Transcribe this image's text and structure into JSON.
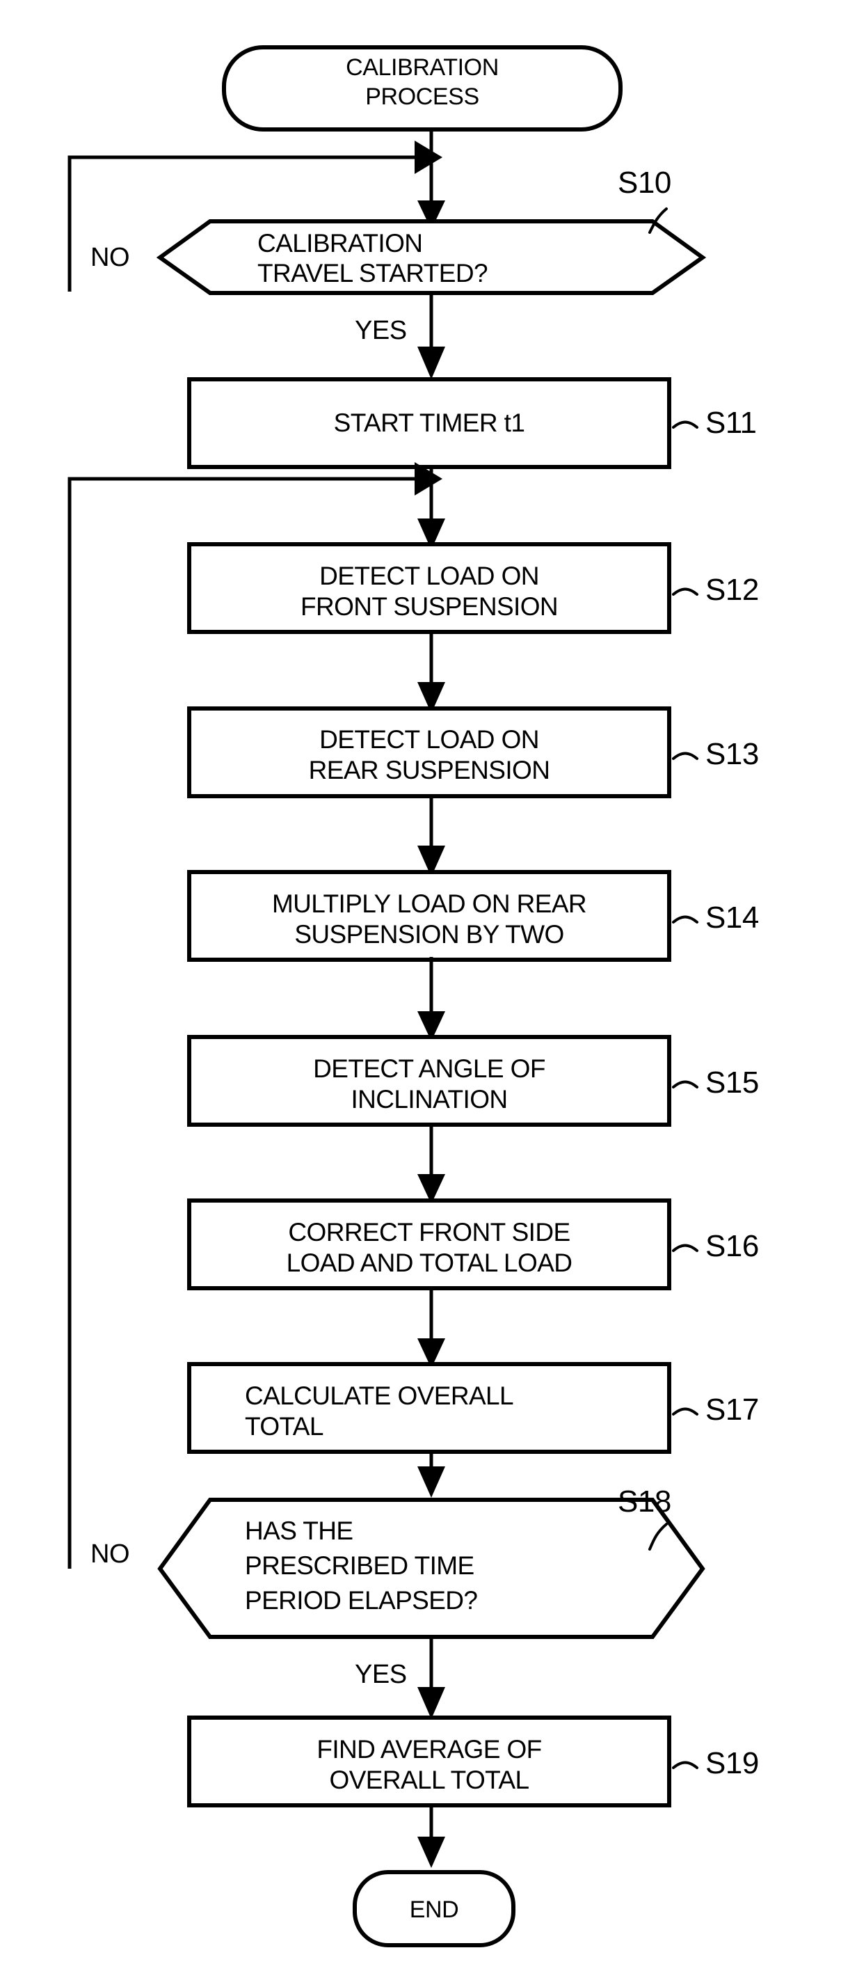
{
  "diagram": {
    "type": "flowchart",
    "title": "CALIBRATION PROCESS",
    "nodes": [
      {
        "id": "start",
        "shape": "terminator",
        "lines": [
          "CALIBRATION",
          "PROCESS"
        ],
        "step": ""
      },
      {
        "id": "s10",
        "shape": "decision",
        "lines": [
          "CALIBRATION",
          "TRAVEL STARTED?"
        ],
        "step": "S10",
        "yes": "YES",
        "no": "NO"
      },
      {
        "id": "s11",
        "shape": "process",
        "lines": [
          "START TIMER t1"
        ],
        "step": "S11"
      },
      {
        "id": "s12",
        "shape": "process",
        "lines": [
          "DETECT LOAD ON",
          "FRONT SUSPENSION"
        ],
        "step": "S12"
      },
      {
        "id": "s13",
        "shape": "process",
        "lines": [
          "DETECT LOAD ON",
          "REAR SUSPENSION"
        ],
        "step": "S13"
      },
      {
        "id": "s14",
        "shape": "process",
        "lines": [
          "MULTIPLY LOAD ON REAR",
          "SUSPENSION BY TWO"
        ],
        "step": "S14"
      },
      {
        "id": "s15",
        "shape": "process",
        "lines": [
          "DETECT ANGLE OF",
          "INCLINATION"
        ],
        "step": "S15"
      },
      {
        "id": "s16",
        "shape": "process",
        "lines": [
          "CORRECT FRONT SIDE",
          "LOAD AND TOTAL LOAD"
        ],
        "step": "S16"
      },
      {
        "id": "s17",
        "shape": "process",
        "lines": [
          "CALCULATE OVERALL",
          "TOTAL"
        ],
        "step": "S17"
      },
      {
        "id": "s18",
        "shape": "decision",
        "lines": [
          "HAS THE",
          "PRESCRIBED TIME",
          "PERIOD ELAPSED?"
        ],
        "step": "S18",
        "yes": "YES",
        "no": "NO"
      },
      {
        "id": "s19",
        "shape": "process",
        "lines": [
          "FIND AVERAGE OF",
          "OVERALL TOTAL"
        ],
        "step": "S19"
      },
      {
        "id": "end",
        "shape": "terminator",
        "lines": [
          "END"
        ],
        "step": ""
      }
    ],
    "colors": {
      "stroke": "#000000",
      "fill": "#ffffff",
      "background": "#ffffff"
    }
  },
  "nodes": {
    "start": {
      "l0": "CALIBRATION",
      "l1": "PROCESS"
    },
    "s10": {
      "l0": "CALIBRATION",
      "l1": "TRAVEL STARTED?",
      "step": "S10",
      "no": "NO",
      "yes": "YES"
    },
    "s11": {
      "l0": "START TIMER t1",
      "step": "S11"
    },
    "s12": {
      "l0": "DETECT LOAD ON",
      "l1": "FRONT SUSPENSION",
      "step": "S12"
    },
    "s13": {
      "l0": "DETECT LOAD ON",
      "l1": "REAR SUSPENSION",
      "step": "S13"
    },
    "s14": {
      "l0": "MULTIPLY LOAD ON REAR",
      "l1": "SUSPENSION BY TWO",
      "step": "S14"
    },
    "s15": {
      "l0": "DETECT ANGLE OF",
      "l1": "INCLINATION",
      "step": "S15"
    },
    "s16": {
      "l0": "CORRECT FRONT SIDE",
      "l1": "LOAD AND TOTAL LOAD",
      "step": "S16"
    },
    "s17": {
      "l0": "CALCULATE OVERALL",
      "l1": "TOTAL",
      "step": "S17"
    },
    "s18": {
      "l0": "HAS THE",
      "l1": "PRESCRIBED TIME",
      "l2": "PERIOD ELAPSED?",
      "step": "S18",
      "no": "NO",
      "yes": "YES"
    },
    "s19": {
      "l0": "FIND AVERAGE OF",
      "l1": "OVERALL TOTAL",
      "step": "S19"
    },
    "end": {
      "l0": "END"
    }
  }
}
